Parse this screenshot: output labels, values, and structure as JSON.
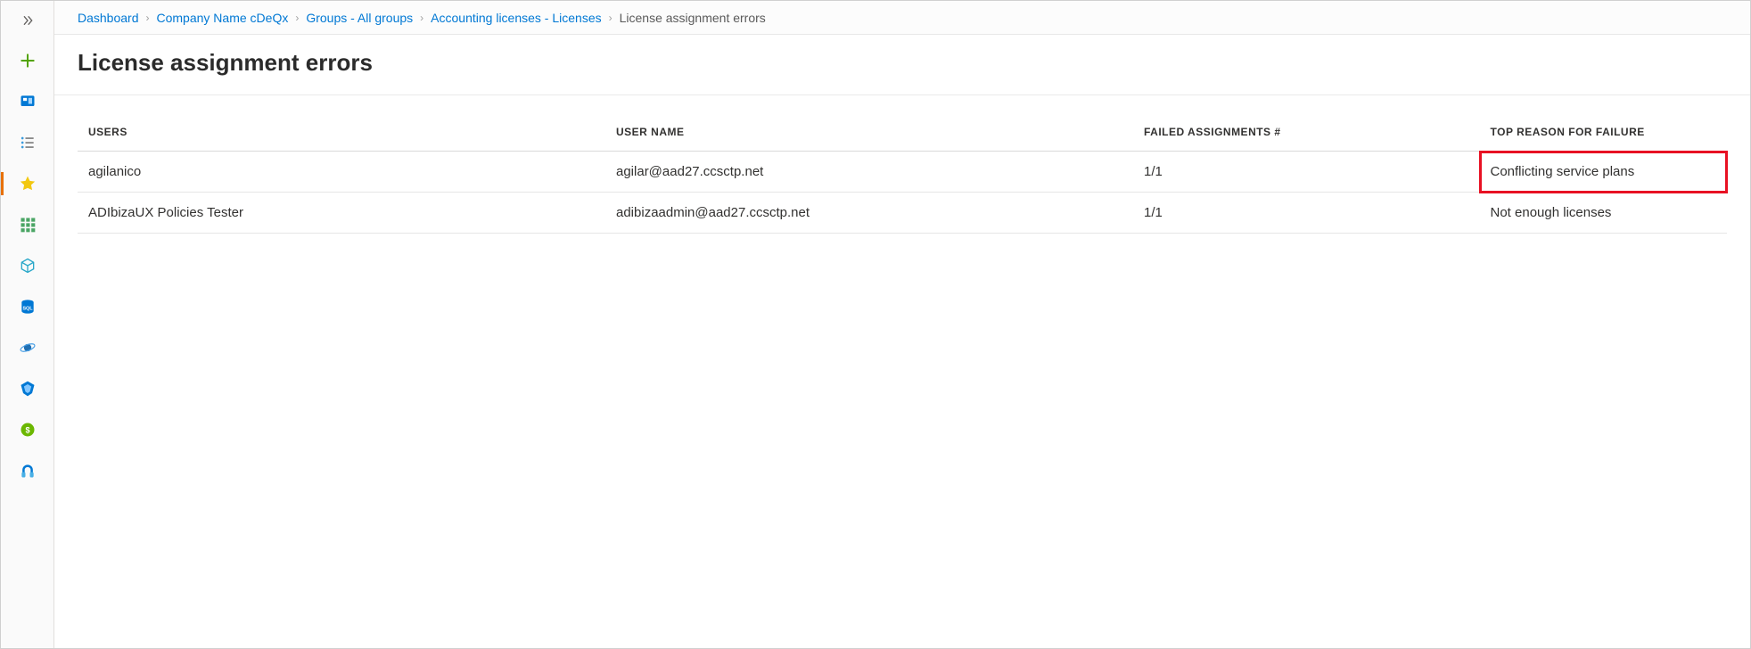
{
  "sidebar": {
    "icons": [
      "create-icon",
      "dashboard-icon",
      "list-icon",
      "favorites-icon",
      "all-resources-icon",
      "cube-icon",
      "sql-database-icon",
      "cosmos-db-icon",
      "devops-icon",
      "cost-icon",
      "support-icon"
    ]
  },
  "breadcrumb": {
    "items": [
      {
        "label": "Dashboard",
        "link": true
      },
      {
        "label": "Company Name cDeQx",
        "link": true
      },
      {
        "label": "Groups - All groups",
        "link": true
      },
      {
        "label": "Accounting licenses - Licenses",
        "link": true
      },
      {
        "label": "License assignment errors",
        "link": false
      }
    ]
  },
  "page": {
    "title": "License assignment errors"
  },
  "table": {
    "headers": {
      "users": "USERS",
      "user_name": "USER NAME",
      "failed": "FAILED ASSIGNMENTS #",
      "reason": "TOP REASON FOR FAILURE"
    },
    "rows": [
      {
        "user": "agilanico",
        "user_name": "agilar@aad27.ccsctp.net",
        "failed": "1/1",
        "reason": "Conflicting service plans",
        "highlight_reason": true
      },
      {
        "user": "ADIbizaUX Policies Tester",
        "user_name": "adibizaadmin@aad27.ccsctp.net",
        "failed": "1/1",
        "reason": "Not enough licenses",
        "highlight_reason": false
      }
    ]
  },
  "colors": {
    "link": "#0078d4",
    "highlight_border": "#e81123"
  }
}
